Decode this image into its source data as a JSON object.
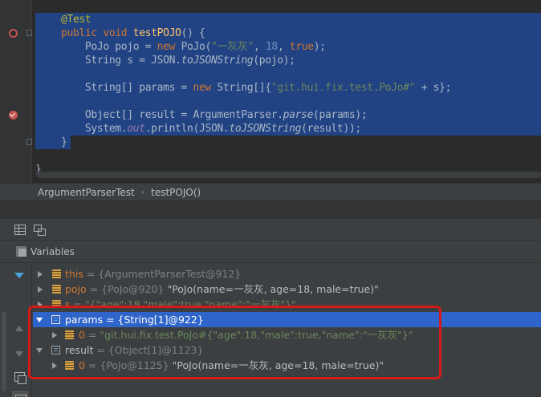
{
  "editor": {
    "lines": {
      "l1_annotation": "@Test",
      "l2_public": "public",
      "l2_void": "void",
      "l2_method": "testPOJO",
      "l2_rest": "() {",
      "l3_type": "PoJo pojo = ",
      "l3_new": "new",
      "l3_ctor": " PoJo(",
      "l3_str": "\"一灰灰\"",
      "l3_sep1": ", ",
      "l3_num": "18",
      "l3_sep2": ", ",
      "l3_true": "true",
      "l3_end": ");",
      "l4_decl": "String s = JSON.",
      "l4_call": "toJSONString",
      "l4_end": "(pojo);",
      "l6_decl": "String[] params = ",
      "l6_new": "new",
      "l6_type": " String[]{",
      "l6_str": "\"git.hui.fix.test.PoJo#\"",
      "l6_end": " + s};",
      "l8_decl": "Object[] result = ArgumentParser.",
      "l8_call": "parse",
      "l8_end": "(params);",
      "l9_sys": "System.",
      "l9_out": "out",
      "l9_mid": ".println(JSON.",
      "l9_call": "toJSONString",
      "l9_end": "(result));",
      "l10_close": "}",
      "l12_close": "}"
    }
  },
  "breadcrumb": {
    "class_name": "ArgumentParserTest",
    "separator": "›",
    "method_name": "testPOJO()"
  },
  "variables_panel": {
    "title": "Variables",
    "rows": [
      {
        "name": "this",
        "eq": " = ",
        "type": "{ArgumentParserTest@912}",
        "value": "",
        "expanded": false
      },
      {
        "name": "pojo",
        "eq": " = ",
        "type": "{PoJo@920}",
        "value": " \"PoJo(name=一灰灰, age=18, male=true)\"",
        "expanded": false
      },
      {
        "name": "s",
        "eq": " = ",
        "type": "",
        "value": "\"{\"age\":18,\"male\":true,\"name\":\"一灰灰\"}\"",
        "expanded": false
      },
      {
        "name": "params",
        "eq": " = ",
        "type": "{String[1]@922}",
        "value": "",
        "expanded": true,
        "selected": true
      },
      {
        "name": "0",
        "eq": " = ",
        "type": "",
        "value": "\"git.hui.fix.test.PoJo#{\"age\":18,\"male\":true,\"name\":\"一灰灰\"}\"",
        "child": true
      },
      {
        "name": "result",
        "eq": " = ",
        "type": "{Object[1]@1123}",
        "value": "",
        "expanded": true
      },
      {
        "name": "0",
        "eq": " = ",
        "type": "{PoJo@1125}",
        "value": " \"PoJo(name=一灰灰, age=18, male=true)\"",
        "child": true
      }
    ]
  },
  "colors": {
    "selection_bg": "#214283",
    "keyword": "#cc7832",
    "string": "#6a8759",
    "number": "#6897bb",
    "annotation": "#bbb529",
    "highlight_box": "#d51a1a",
    "tree_selected": "#2f65ca"
  },
  "icons": [
    "intention-bulb-icon",
    "run-breakpoint-icon",
    "breakpoint-hit-icon",
    "fold-icon",
    "table-icon",
    "restore-layout-icon",
    "variables-icon",
    "filter-icon",
    "up-icon",
    "down-icon",
    "copy-icon",
    "watch-icon",
    "expand-arrow-icon",
    "field-icon",
    "array-icon"
  ]
}
